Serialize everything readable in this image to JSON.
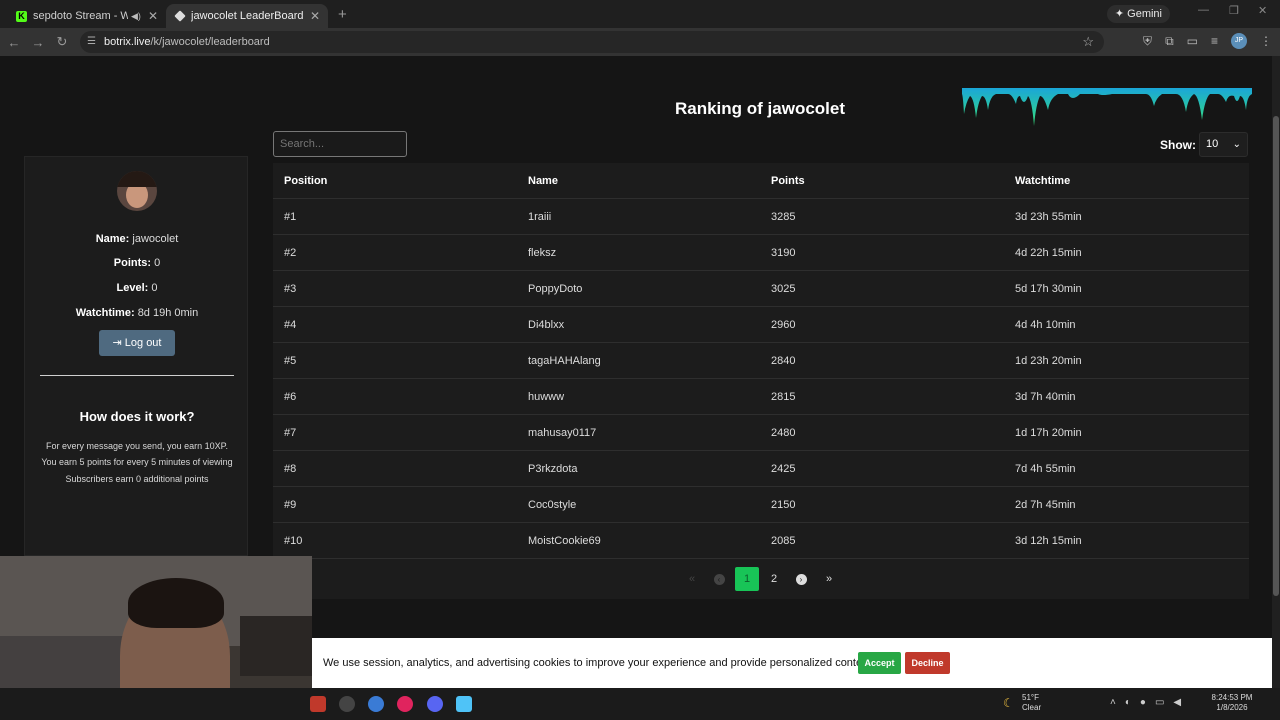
{
  "browser": {
    "tabs": [
      {
        "title": "sepdoto Stream - Watch Live",
        "favicon": "kick-icon",
        "audio": true
      },
      {
        "title": "jawocolet LeaderBoard | The be",
        "favicon": "botrix-icon",
        "active": true
      }
    ],
    "gemini_label": "Gemini",
    "url_domain": "botrix.live",
    "url_path": "/k/jawocolet/leaderboard",
    "profile_initials": "JP"
  },
  "page": {
    "title": "Ranking of jawocolet",
    "search_placeholder": "Search...",
    "show_label": "Show:",
    "show_value": "10"
  },
  "sidebar": {
    "name_label": "Name:",
    "name_value": "jawocolet",
    "points_label": "Points:",
    "points_value": "0",
    "level_label": "Level:",
    "level_value": "0",
    "watchtime_label": "Watchtime:",
    "watchtime_value": "8d 19h 0min",
    "logout_label": "Log out",
    "how_title": "How does it work?",
    "rules": [
      "For every message you send, you earn 10XP.",
      "You earn 5 points for every 5 minutes of viewing",
      "Subscribers earn 0 additional points"
    ]
  },
  "table": {
    "headers": [
      "Position",
      "Name",
      "Points",
      "Watchtime"
    ],
    "rows": [
      [
        "#1",
        "1raiii",
        "3285",
        "3d 23h 55min"
      ],
      [
        "#2",
        "fleksz",
        "3190",
        "4d 22h 15min"
      ],
      [
        "#3",
        "PoppyDoto",
        "3025",
        "5d 17h 30min"
      ],
      [
        "#4",
        "Di4blxx",
        "2960",
        "4d 4h 10min"
      ],
      [
        "#5",
        "tagaHAHAlang",
        "2840",
        "1d 23h 20min"
      ],
      [
        "#6",
        "huwww",
        "2815",
        "3d 7h 40min"
      ],
      [
        "#7",
        "mahusay0117",
        "2480",
        "1d 17h 20min"
      ],
      [
        "#8",
        "P3rkzdota",
        "2425",
        "7d 4h 55min"
      ],
      [
        "#9",
        "Coc0style",
        "2150",
        "2d 7h 45min"
      ],
      [
        "#10",
        "MoistCookie69",
        "2085",
        "3d 12h 15min"
      ]
    ]
  },
  "pagination": {
    "first": "«",
    "prev": "‹",
    "pages": [
      "1",
      "2"
    ],
    "current": "1",
    "next": "›",
    "last": "»"
  },
  "cookie": {
    "text": "We use session, analytics, and advertising cookies to improve your experience and provide personalized content.",
    "accept": "Accept",
    "decline": "Decline"
  },
  "taskbar": {
    "temperature": "51°F",
    "condition": "Clear",
    "time": "8:24:53 PM",
    "date": "1/8/2026"
  },
  "colors": {
    "accent_green": "#18c457",
    "logout_btn": "#4f6a80",
    "decline_red": "#c0392b"
  }
}
